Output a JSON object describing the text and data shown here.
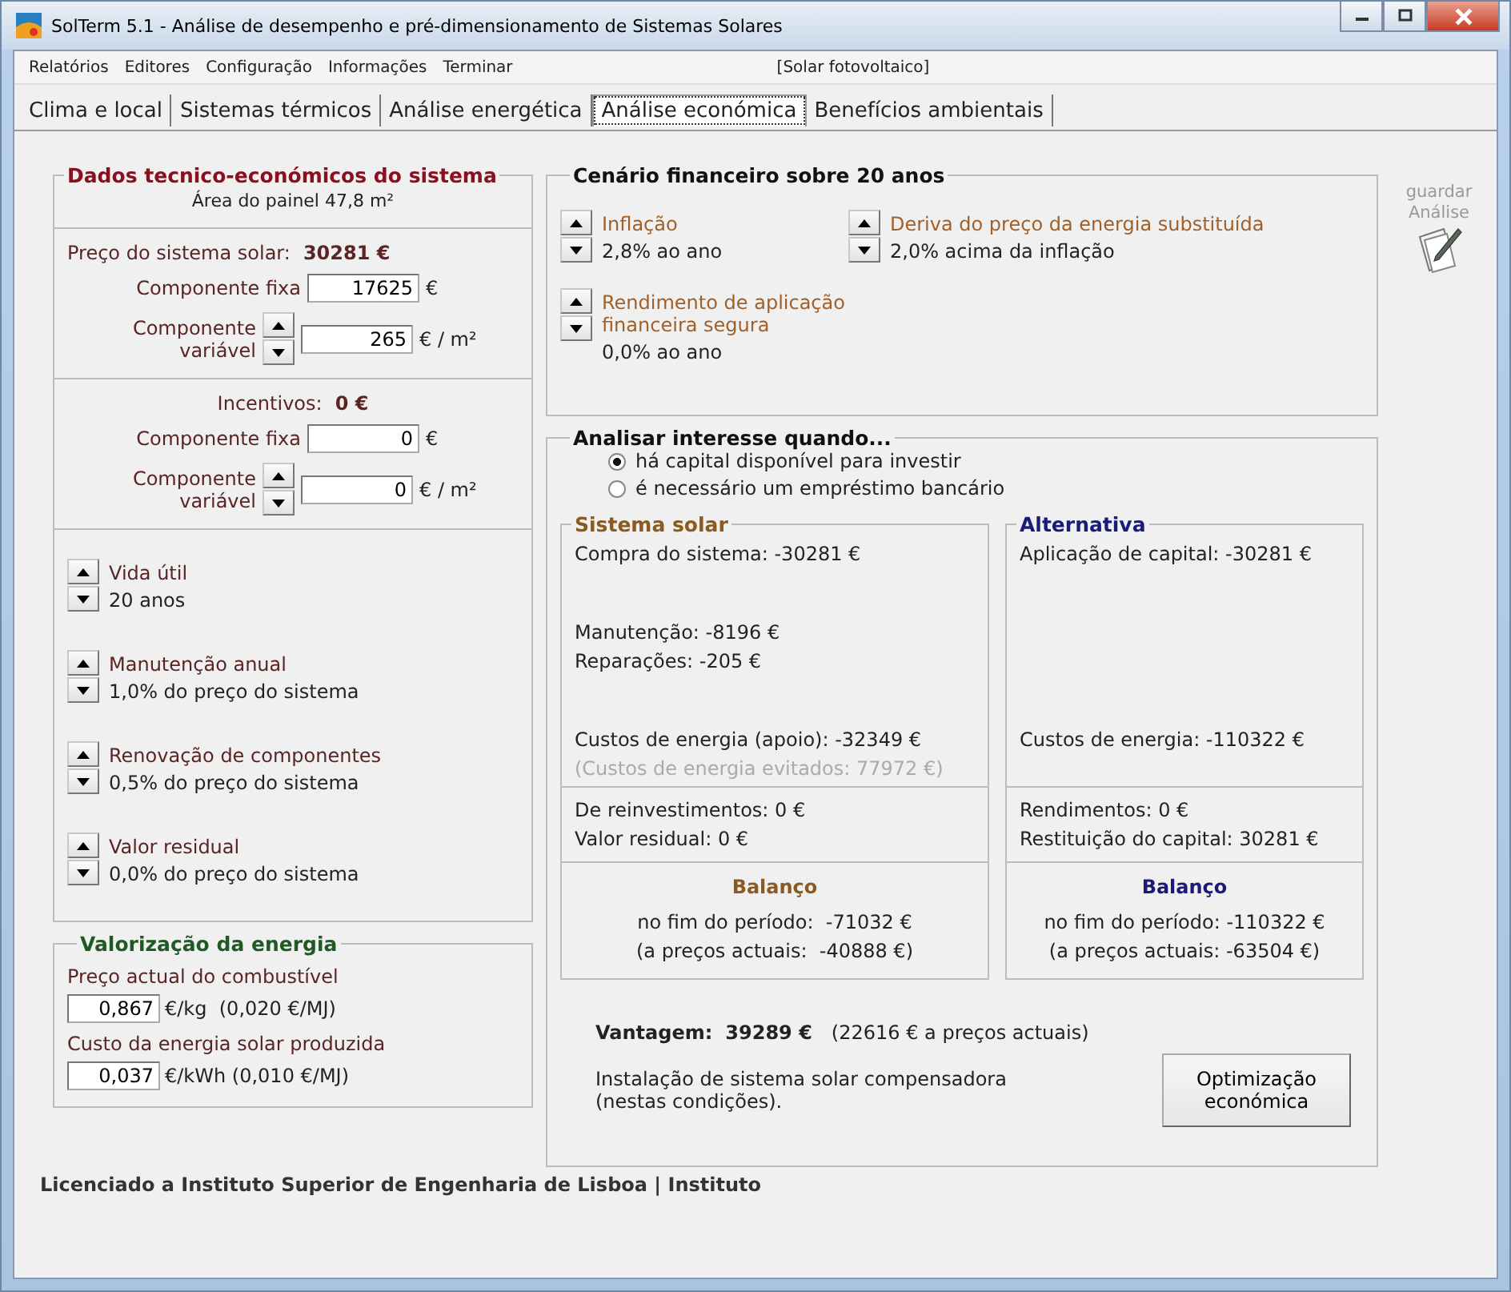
{
  "window": {
    "title": "SolTerm 5.1 - Análise de desempenho e pré-dimensionamento de Sistemas Solares"
  },
  "menu": {
    "items": [
      "Relatórios",
      "Editores",
      "Configuração",
      "Informações",
      "Terminar"
    ],
    "mode": "[Solar fotovoltaico]"
  },
  "tabs": [
    {
      "label": "Clima e local",
      "selected": false
    },
    {
      "label": "Sistemas térmicos",
      "selected": false
    },
    {
      "label": "Análise energética",
      "selected": false
    },
    {
      "label": "Análise económica",
      "selected": true
    },
    {
      "label": "Benefícios ambientais",
      "selected": false
    }
  ],
  "system_data": {
    "title": "Dados tecnico-económicos do sistema",
    "panel_area": "Área do painel 47,8 m²",
    "price": {
      "label": "Preço do sistema solar:",
      "value": "30281 €",
      "fixed": {
        "label": "Componente fixa",
        "value": "17625",
        "unit": "€"
      },
      "variable": {
        "label": "Componente variável",
        "value": "265",
        "unit": "€ / m²"
      }
    },
    "incentives": {
      "label": "Incentivos:",
      "value": "0 €",
      "fixed": {
        "label": "Componente fixa",
        "value": "0",
        "unit": "€"
      },
      "variable": {
        "label": "Componente variável",
        "value": "0",
        "unit": "€ / m²"
      }
    },
    "parameters": [
      {
        "label": "Vida útil",
        "value": "20 anos"
      },
      {
        "label": "Manutenção anual",
        "value": "1,0% do preço do sistema"
      },
      {
        "label": "Renovação de componentes",
        "value": "0,5% do preço do sistema"
      },
      {
        "label": "Valor residual",
        "value": "0,0% do preço do sistema"
      }
    ]
  },
  "energy_valuation": {
    "title": "Valorização da energia",
    "items": [
      {
        "label": "Preço actual do combustível",
        "value": "0,867",
        "unit": "€/kg  (0,020 €/MJ)"
      },
      {
        "label": "Custo da energia solar produzida",
        "value": "0,037",
        "unit": "€/kWh (0,010 €/MJ)"
      }
    ]
  },
  "financial_scenario": {
    "title": "Cenário financeiro sobre 20 anos",
    "parameters": [
      {
        "label": "Inflação",
        "value": "2,8% ao ano"
      },
      {
        "label": "Deriva do preço da energia substituída",
        "value": "2,0% acima da inflação"
      },
      {
        "label": "Rendimento de aplicação financeira segura",
        "value": "0,0% ao ano"
      }
    ]
  },
  "save_button": {
    "label": "guardar Análise"
  },
  "analysis": {
    "title": "Analisar interesse quando...",
    "options": [
      {
        "label": "há capital disponível para investir",
        "selected": true
      },
      {
        "label": "é necessário um empréstimo bancário",
        "selected": false
      }
    ],
    "columns": [
      {
        "title": "Sistema solar",
        "kind": "solar",
        "cost_groups": [
          [
            {
              "text": "Compra do sistema: -30281 €",
              "muted": false
            }
          ],
          [
            {
              "text": "Manutenção: -8196 €",
              "muted": false
            },
            {
              "text": "Reparações: -205 €",
              "muted": false
            }
          ],
          [
            {
              "text": "Custos de energia (apoio): -32349 €",
              "muted": false
            },
            {
              "text": "(Custos de energia evitados: 77972 €)",
              "muted": true
            }
          ]
        ],
        "returns": [
          "De reinvestimentos: 0 €",
          "Valor residual: 0 €"
        ],
        "balance_title": "Balanço",
        "balance": [
          "no fim do período:  -71032 €",
          "(a preços actuais:  -40888 €)"
        ]
      },
      {
        "title": "Alternativa",
        "kind": "alternative",
        "cost_groups": [
          [
            {
              "text": "Aplicação de capital: -30281 €",
              "muted": false
            }
          ],
          [
            {
              "text": "Custos de energia: -110322 €",
              "muted": false
            }
          ]
        ],
        "returns": [
          "Rendimentos: 0 €",
          "Restituição do capital: 30281 €"
        ],
        "balance_title": "Balanço",
        "balance": [
          "no fim do período: -110322 €",
          "(a preços actuais: -63504 €)"
        ]
      }
    ],
    "advantage": {
      "label": "Vantagem:",
      "value": "39289 €",
      "note": "(22616 € a preços actuais)"
    },
    "conclusion": "Instalação de sistema solar compensadora (nestas condições).",
    "optimize_button": "Optimização económica"
  },
  "footer": "Licenciado a Instituto Superior de Engenharia de Lisboa | Instituto"
}
